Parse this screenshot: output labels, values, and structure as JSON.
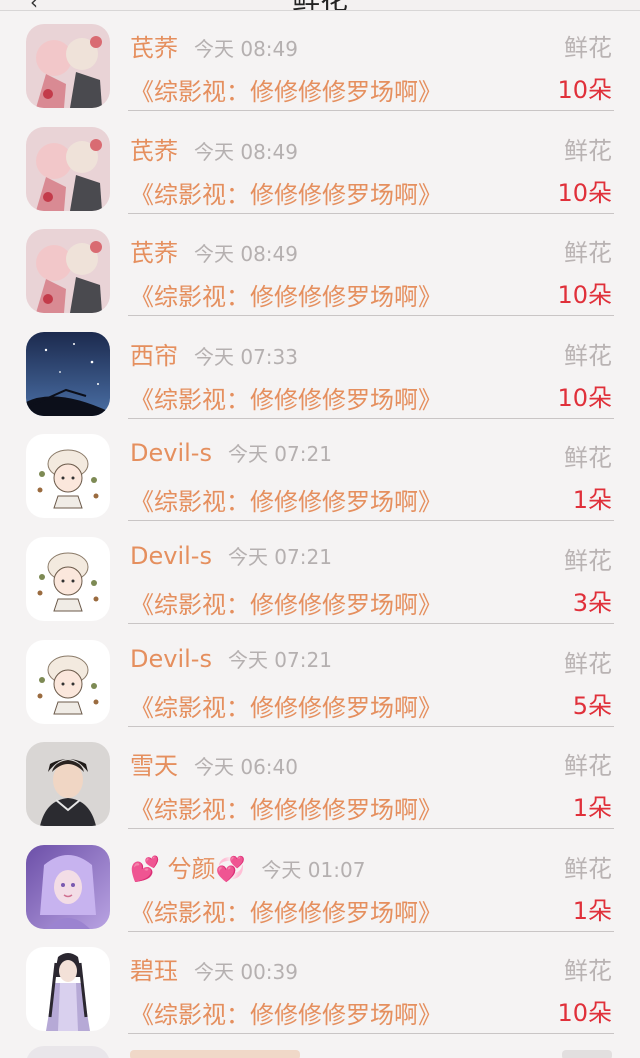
{
  "header": {
    "title": "鲜花",
    "back_icon": "chevron-left-icon"
  },
  "colors": {
    "name": "#e58f5e",
    "time": "#b5b0b0",
    "count": "#e0303a",
    "label": "#b9b3b3",
    "background": "#f5f3f3"
  },
  "items": [
    {
      "name": "芪荞",
      "time": "今天 08:49",
      "label": "鲜花",
      "book": "《综影视：修修修修罗场啊》",
      "count": "10朵",
      "avatar": "anime-couple-pink"
    },
    {
      "name": "芪荞",
      "time": "今天 08:49",
      "label": "鲜花",
      "book": "《综影视：修修修修罗场啊》",
      "count": "10朵",
      "avatar": "anime-couple-pink"
    },
    {
      "name": "芪荞",
      "time": "今天 08:49",
      "label": "鲜花",
      "book": "《综影视：修修修修罗场啊》",
      "count": "10朵",
      "avatar": "anime-couple-pink"
    },
    {
      "name": "西帘",
      "time": "今天 07:33",
      "label": "鲜花",
      "book": "《综影视：修修修修罗场啊》",
      "count": "10朵",
      "avatar": "night-sky"
    },
    {
      "name": "Devil-s",
      "time": "今天 07:21",
      "label": "鲜花",
      "book": "《综影视：修修修修罗场啊》",
      "count": "1朵",
      "avatar": "cartoon-girl-sheep-hat"
    },
    {
      "name": "Devil-s",
      "time": "今天 07:21",
      "label": "鲜花",
      "book": "《综影视：修修修修罗场啊》",
      "count": "3朵",
      "avatar": "cartoon-girl-sheep-hat"
    },
    {
      "name": "Devil-s",
      "time": "今天 07:21",
      "label": "鲜花",
      "book": "《综影视：修修修修罗场啊》",
      "count": "5朵",
      "avatar": "cartoon-girl-sheep-hat"
    },
    {
      "name": "雪天",
      "time": "今天 06:40",
      "label": "鲜花",
      "book": "《综影视：修修修修罗场啊》",
      "count": "1朵",
      "avatar": "man-portrait"
    },
    {
      "name": "兮颜",
      "name_prefix": "💕",
      "name_suffix": "💞",
      "time": "今天 01:07",
      "label": "鲜花",
      "book": "《综影视：修修修修罗场啊》",
      "count": "1朵",
      "avatar": "purple-fantasy-girl"
    },
    {
      "name": "碧珏",
      "time": "今天 00:39",
      "label": "鲜花",
      "book": "《综影视：修修修修罗场啊》",
      "count": "10朵",
      "avatar": "ancient-costume-girl"
    }
  ]
}
